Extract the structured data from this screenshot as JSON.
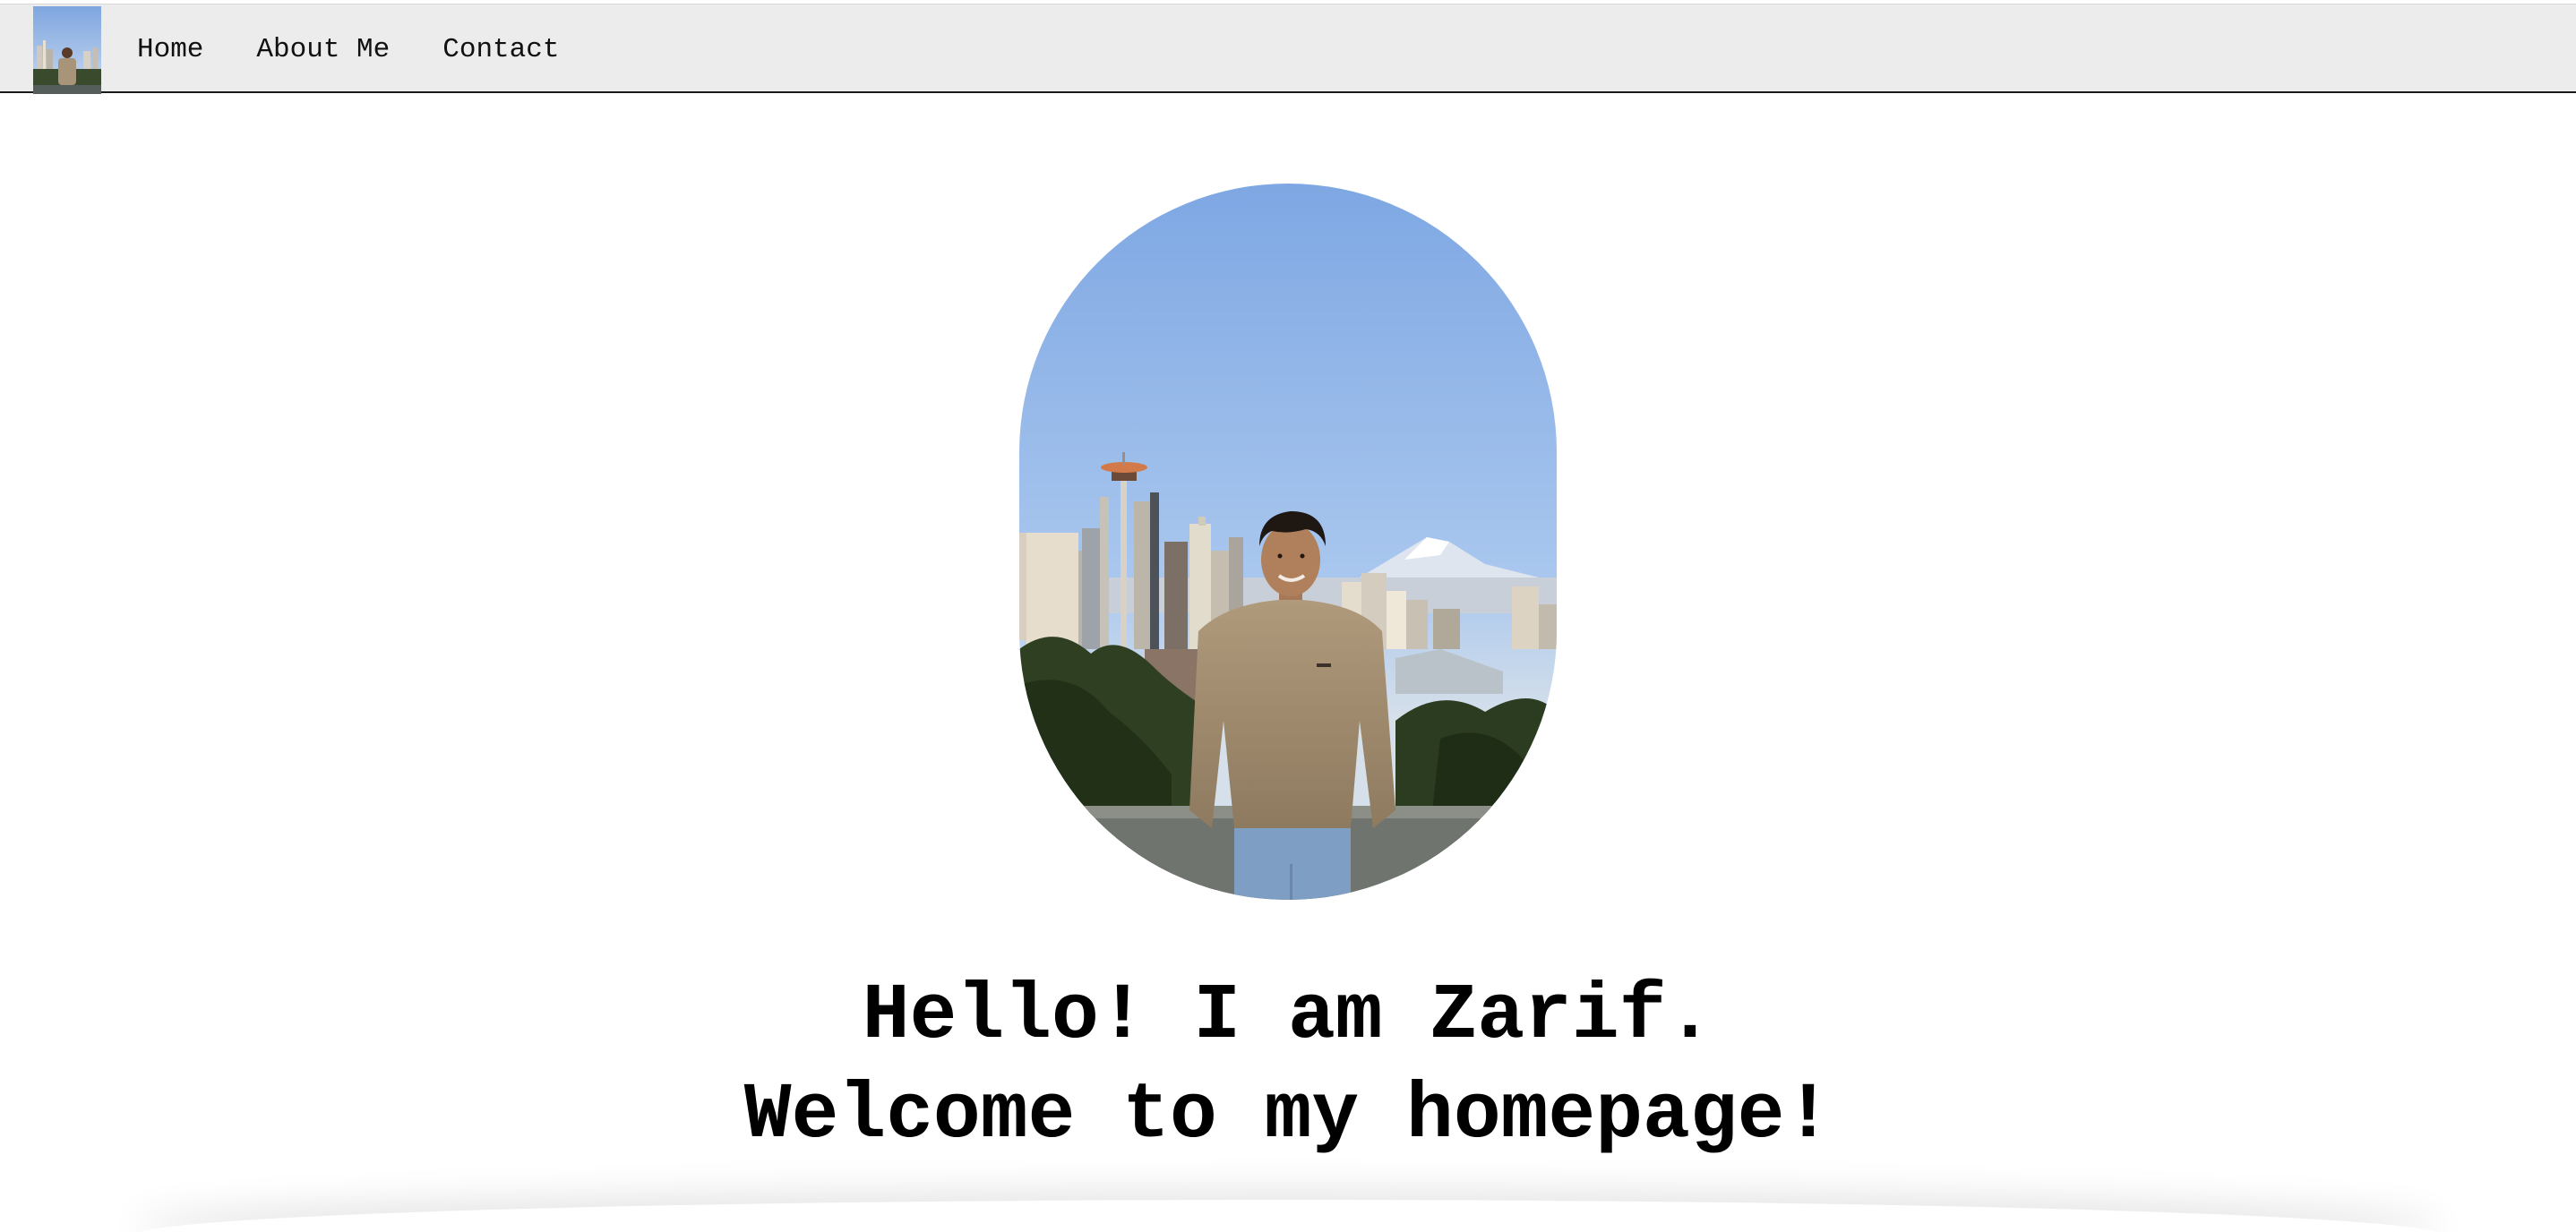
{
  "nav": {
    "logo_icon": "profile-photo-thumbnail",
    "links": [
      {
        "label": "Home"
      },
      {
        "label": "About Me"
      },
      {
        "label": "Contact"
      }
    ]
  },
  "hero": {
    "photo_icon": "profile-photo-seattle-skyline",
    "greeting_line_1": "Hello! I am Zarif.",
    "greeting_line_2": "Welcome to my homepage!"
  },
  "colors": {
    "nav_background": "#ececec",
    "nav_border": "#1a1a1a",
    "page_background": "#ffffff",
    "text": "#000000"
  }
}
